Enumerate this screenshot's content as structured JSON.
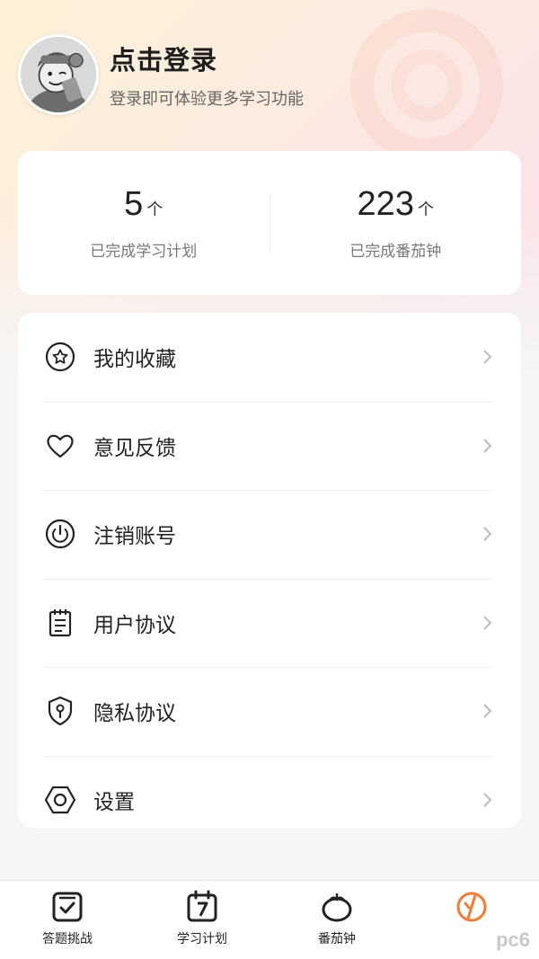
{
  "profile": {
    "title": "点击登录",
    "subtitle": "登录即可体验更多学习功能"
  },
  "stats": [
    {
      "value": "5",
      "unit": "个",
      "label": "已完成学习计划"
    },
    {
      "value": "223",
      "unit": "个",
      "label": "已完成番茄钟"
    }
  ],
  "menu": [
    {
      "label": "我的收藏",
      "icon": "star-circle-icon"
    },
    {
      "label": "意见反馈",
      "icon": "heart-icon"
    },
    {
      "label": "注销账号",
      "icon": "power-icon"
    },
    {
      "label": "用户协议",
      "icon": "notepad-icon"
    },
    {
      "label": "隐私协议",
      "icon": "shield-lock-icon"
    },
    {
      "label": "设置",
      "icon": "hexagon-settings-icon"
    }
  ],
  "tabbar": [
    {
      "label": "答题挑战",
      "icon": "check-square-icon"
    },
    {
      "label": "学习计划",
      "icon": "calendar-7-icon"
    },
    {
      "label": "番茄钟",
      "icon": "tomato-icon"
    },
    {
      "label": "",
      "icon": "profile-active-icon",
      "active": true
    }
  ],
  "watermark": "pc6",
  "colors": {
    "accent": "#f07b3a",
    "text": "#222222",
    "muted": "#777777"
  }
}
